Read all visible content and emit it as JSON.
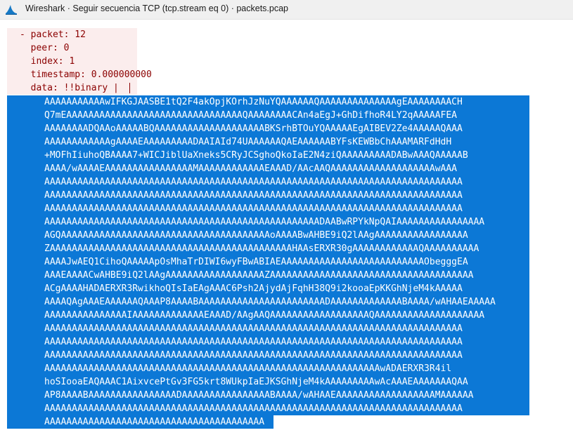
{
  "window": {
    "title": "Wireshark · Seguir secuencia TCP (tcp.stream eq 0) · packets.pcap",
    "icon": "wireshark-fin-icon"
  },
  "stream": {
    "header_lines": [
      "- packet: 12",
      "  peer: 0",
      "  index: 1",
      "  timestamp: 0.000000000",
      "  data: !!binary |"
    ],
    "base64_lines": [
      "AAAAAAAAAAAwIFKGJAASBE1tQ2F4akOpjKOrhJzNuYQAAAAAAQAAAAAAAAAAAAAAgEAAAAAAAACH",
      "Q7mEAAAAAAAAAAAAAAAAAAAAAAAAAAAAAAAAQAAAAAAAACAn4aEgJ+GhDifhoR4LY2qAAAAAFEA",
      "AAAAAAAADQAAoAAAAABQAAAAAAAAAAAAAAAAAAAABKSrhBTOuYQAAAAAEgAIBEV2Ze4AAAAAQAAA",
      "AAAAAAAAAAAAgAAAAEAAAAAAAAADAAIAId74UAAAAAAQAEAAAAAABYFsKEWBbChAAAMARFdHdH",
      "+MOFhIiuhoQBAAAA7+WICJiblUaXneks5CRyJCSghoQkoIaE2N4ziQAAAAAAAAADABwAAAQAAAAAB",
      "AAAA/wAAAAEAAAAAAAAAAAAAAAAMAAAAAAAAAAAAEAAAD/AAcAAQAAAAAAAAAAAAAAAAAAAwAAA",
      "AAAAAAAAAAAAAAAAAAAAAAAAAAAAAAAAAAAAAAAAAAAAAAAAAAAAAAAAAAAAAAAAAAAAAAAAAAAA",
      "AAAAAAAAAAAAAAAAAAAAAAAAAAAAAAAAAAAAAAAAAAAAAAAAAAAAAAAAAAAAAAAAAAAAAAAAAAAA",
      "AAAAAAAAAAAAAAAAAAAAAAAAAAAAAAAAAAAAAAAAAAAAAAAAAAAAAAAAAAAAAAAAAAAAAAAAAAAA",
      "AAAAAAAAAAAAAAAAAAAAAAAAAAAAAAAAAAAAAAAAAAAAAAAAAADAABwRPYkNpQAIAAAAAAAAAAAAAAAA",
      "AGQAAAAAAAAAAAAAAAAAAAAAAAAAAAAAAAAAAAAAAoAAAABwAHBE9iQ2lAAgAAAAAAAAAAAAAAAAA",
      "ZAAAAAAAAAAAAAAAAAAAAAAAAAAAAAAAAAAAAAAAAAAAAHAAsERXR30gAAAAAAAAAAAAQAAAAAAAAAA",
      "AAAAJwAEQ1CihoQAAAAApOsMhaTrDIWI6wyFBwABIAEAAAAAAAAAAAAAAAAAAAAAAAAAAObegggEA",
      "AAAEAAAACwAHBE9iQ2lAAgAAAAAAAAAAAAAAAAAAZAAAAAAAAAAAAAAAAAAAAAAAAAAAAAAAAAAAAA",
      "ACgAAAAHADAERXR3RwikhoQIsIaEAgAAAC6Psh2AjydAjFqhH38Q9i2kooaEpKKGhNjeM4kAAAAA",
      "AAAAQAgAAAEAAAAAAQAAAP8AAAABAAAAAAAAAAAAAAAAAAAAAAADAAAAAAAAAAAAABAAAA/wAHAAEAAAAA",
      "AAAAAAAAAAAAAAAIAAAAAAAAAAAAAEAAAD/AAgAAQAAAAAAAAAAAAAAAAAAQAAAAAAAAAAAAAAAAAAAA",
      "AAAAAAAAAAAAAAAAAAAAAAAAAAAAAAAAAAAAAAAAAAAAAAAAAAAAAAAAAAAAAAAAAAAAAAAAAAAA",
      "AAAAAAAAAAAAAAAAAAAAAAAAAAAAAAAAAAAAAAAAAAAAAAAAAAAAAAAAAAAAAAAAAAAAAAAAAAAA",
      "AAAAAAAAAAAAAAAAAAAAAAAAAAAAAAAAAAAAAAAAAAAAAAAAAAAAAAAAAAAAAAAAAAAAAAAAAAAA",
      "AAAAAAAAAAAAAAAAAAAAAAAAAAAAAAAAAAAAAAAAAAAAAAAAAAAAAAAAAAAAAwADAERXR3R4il",
      "hoSIooaEAQAAAC1AixvcePtGv3FG5krt8WUkpIaEJKSGhNjeM4kAAAAAAAAAwAcAAAEAAAAAAAQAA",
      "AP8AAAABAAAAAAAAAAAAAAAADAAAAAAAAAAAAAAAABAAAA/wAHAAEAAAAAAAAAAAAAAAAAAMAAAAAA",
      "AAAAAAAAAAAAAAAAAAAAAAAAAAAAAAAAAAAAAAAAAAAAAAAAAAAAAAAAAAAAAAAAAAAAAAAAAAAA",
      "AAAAAAAAAAAAAAAAAAAAAAAAAAAAAAAAAAAAAAAA"
    ]
  }
}
